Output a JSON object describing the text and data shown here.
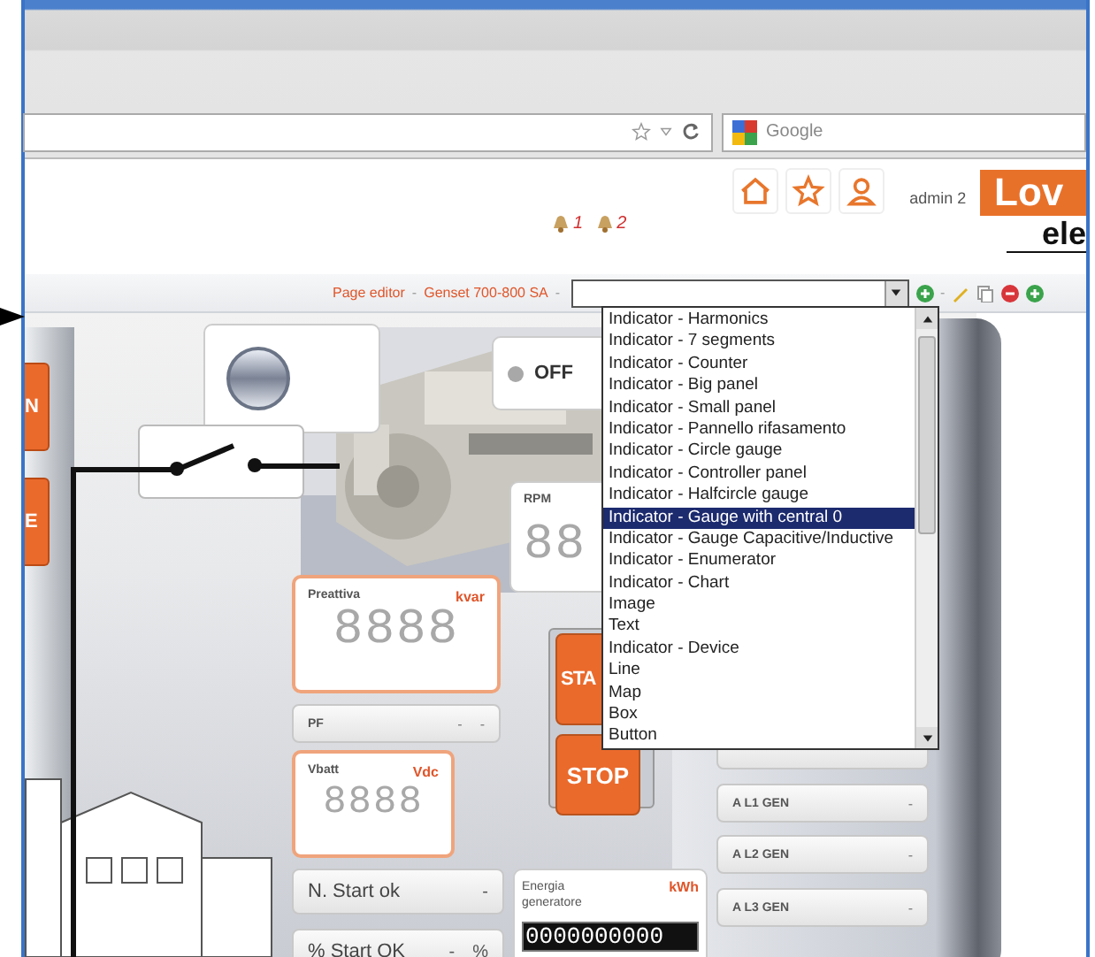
{
  "browser": {
    "search_placeholder": "Google"
  },
  "header": {
    "notifications": [
      {
        "count": "1"
      },
      {
        "count": "2"
      }
    ],
    "user": "admin 2",
    "logo": {
      "top": "Lov",
      "bottom": "ele"
    }
  },
  "toolbar": {
    "breadcrumb": [
      {
        "label": "Page editor",
        "separator": "-"
      },
      {
        "label": "Genset 700-800 SA",
        "separator": "-"
      }
    ],
    "add_separator": "-"
  },
  "widget_select": {
    "expanded": true,
    "options": [
      {
        "label": "Indicator - Harmonics",
        "selected": false
      },
      {
        "label": "Indicator - 7 segments",
        "selected": false
      },
      {
        "label": "Indicator - Counter",
        "selected": false
      },
      {
        "label": "Indicator - Big panel",
        "selected": false
      },
      {
        "label": "Indicator - Small panel",
        "selected": false
      },
      {
        "label": "Indicator - Pannello rifasamento",
        "selected": false
      },
      {
        "label": "Indicator - Circle gauge",
        "selected": false
      },
      {
        "label": "Indicator - Controller panel",
        "selected": false
      },
      {
        "label": "Indicator - Halfcircle gauge",
        "selected": false
      },
      {
        "label": "Indicator - Gauge with central 0",
        "selected": true
      },
      {
        "label": "Indicator - Gauge Capacitive/Inductive",
        "selected": false
      },
      {
        "label": "Indicator - Enumerator",
        "selected": false
      },
      {
        "label": "Indicator - Chart",
        "selected": false
      },
      {
        "label": "Image",
        "selected": false
      },
      {
        "label": "Text",
        "selected": false
      },
      {
        "label": "Indicator - Device",
        "selected": false
      },
      {
        "label": "Line",
        "selected": false
      },
      {
        "label": "Map",
        "selected": false
      },
      {
        "label": "Box",
        "selected": false
      },
      {
        "label": "Button",
        "selected": false
      }
    ]
  },
  "dashboard": {
    "side_buttons": [
      {
        "label": "N"
      },
      {
        "label": "E"
      }
    ],
    "status": {
      "label": "OFF",
      "on": false
    },
    "rpm": {
      "label": "RPM",
      "digits": "88"
    },
    "preattiva": {
      "label": "Preattiva",
      "unit": "kvar",
      "digits": "8888"
    },
    "pf": {
      "label": "PF",
      "value": "-",
      "unit": "-"
    },
    "vbatt": {
      "label": "Vbatt",
      "unit": "Vdc",
      "digits": "8888"
    },
    "n_start": {
      "label": "N. Start ok",
      "value": "-"
    },
    "pct_start": {
      "label": "% Start OK",
      "value": "-",
      "unit": "%"
    },
    "energy": {
      "label": "Energia generatore",
      "unit": "kWh",
      "counter": "0000000000"
    },
    "start_button": {
      "label": "STA"
    },
    "stop_button": {
      "label": "STOP"
    },
    "right_rows": [
      {
        "label": "A L1 GEN",
        "value": "-"
      },
      {
        "label": "A L2 GEN",
        "value": "-"
      },
      {
        "label": "A L3 GEN",
        "value": "-"
      }
    ]
  }
}
